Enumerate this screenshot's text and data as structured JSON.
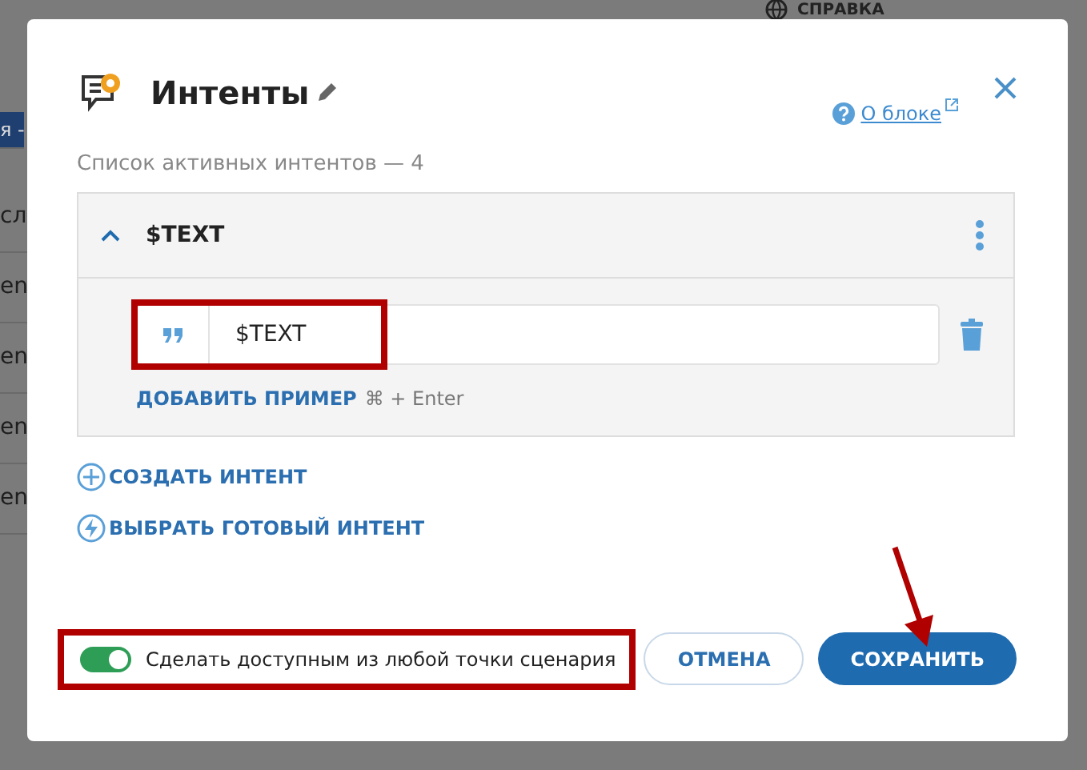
{
  "background": {
    "help_label": "СПРАВКА",
    "left_fragments": [
      "я -",
      "сл",
      "en",
      "en",
      "en",
      "en"
    ]
  },
  "dialog": {
    "title": "Интенты",
    "about_link": "О блоке",
    "subtitle": "Список активных интентов — 4",
    "intents": [
      {
        "name": "$TEXT",
        "expanded": true,
        "examples": [
          {
            "text": "$TEXT",
            "highlighted": true
          }
        ],
        "add_example": "ДОБАВИТЬ ПРИМЕР",
        "shortcut": "⌘ + Enter"
      }
    ],
    "actions": [
      {
        "kind": "create",
        "label": "СОЗДАТЬ ИНТЕНТ"
      },
      {
        "kind": "choose",
        "label": "ВЫБРАТЬ ГОТОВЫЙ ИНТЕНТ"
      }
    ],
    "global_toggle": {
      "label": "Сделать доступным из любой точки сценария",
      "on": true,
      "highlighted": true
    },
    "buttons": [
      {
        "kind": "secondary",
        "label": "ОТМЕНА"
      },
      {
        "kind": "primary",
        "label": "СОХРАНИТЬ"
      }
    ]
  },
  "annotations": [
    {
      "kind": "arrow"
    }
  ]
}
